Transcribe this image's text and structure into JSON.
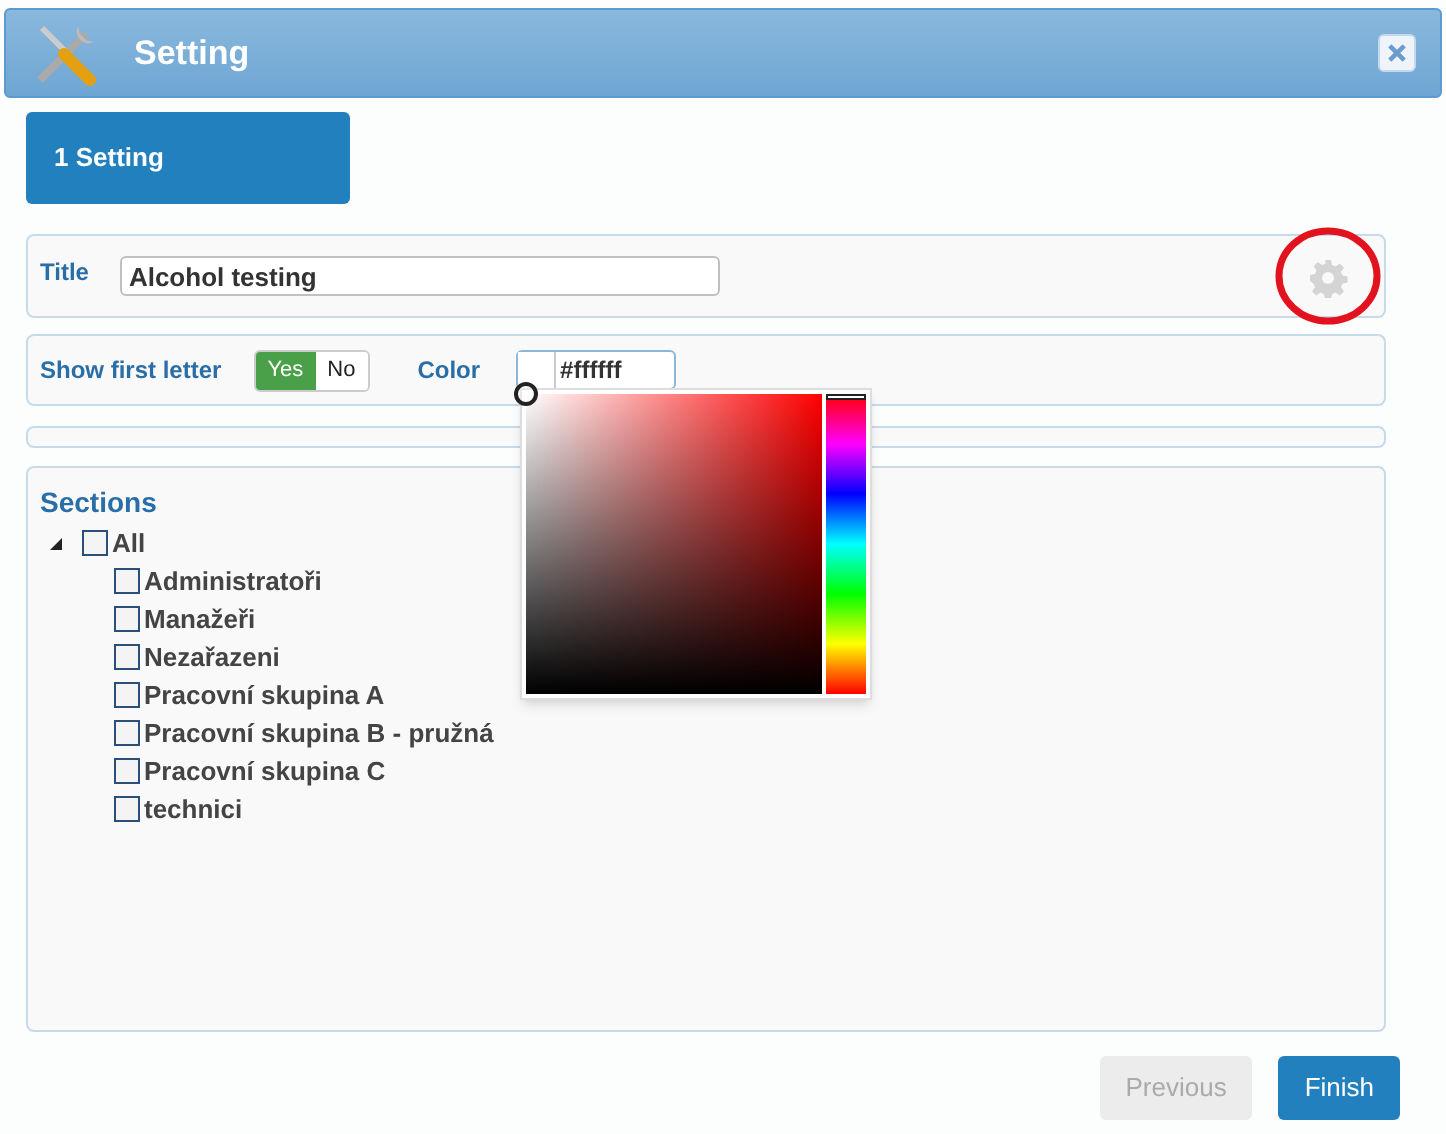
{
  "window": {
    "title": "Setting"
  },
  "steps": [
    {
      "label": "1 Setting",
      "selected": true
    }
  ],
  "title_field": {
    "label": "Title",
    "value": "Alcohol testing"
  },
  "show_first_letter": {
    "label": "Show first letter",
    "options": [
      {
        "label": "Yes",
        "selected": true
      },
      {
        "label": "No",
        "selected": false
      }
    ]
  },
  "color": {
    "label": "Color",
    "value": "#ffffff",
    "color": "#ffffff",
    "picker_open": true
  },
  "sections": {
    "heading": "Sections",
    "tree": [
      {
        "label": "All",
        "checked": false,
        "expanded": true,
        "children": [
          {
            "label": "Administratoři",
            "checked": false
          },
          {
            "label": "Manažeři",
            "checked": false
          },
          {
            "label": "Nezařazeni",
            "checked": false
          },
          {
            "label": "Pracovní skupina A",
            "checked": false
          },
          {
            "label": "Pracovní skupina B - pružná",
            "checked": false
          },
          {
            "label": "Pracovní skupina C",
            "checked": false
          },
          {
            "label": "technici",
            "checked": false
          }
        ]
      }
    ]
  },
  "buttons": [
    {
      "label": "Previous",
      "disabled": true
    },
    {
      "label": "Finish",
      "disabled": false
    }
  ]
}
